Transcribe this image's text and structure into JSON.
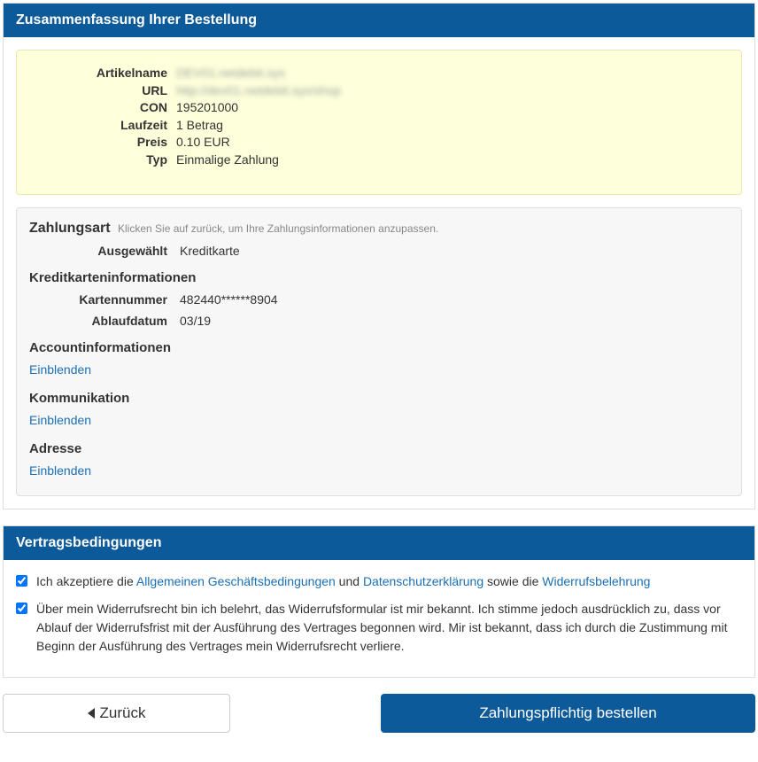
{
  "summary": {
    "header": "Zusammenfassung Ihrer Bestellung",
    "items": {
      "artikelname_label": "Artikelname",
      "artikelname_value": "DEV01.netdebit.sys",
      "url_label": "URL",
      "url_value": "http://dev01.netdebit.sys/shop",
      "con_label": "CON",
      "con_value": "195201000",
      "laufzeit_label": "Laufzeit",
      "laufzeit_value": "1 Betrag",
      "preis_label": "Preis",
      "preis_value": "0.10 EUR",
      "typ_label": "Typ",
      "typ_value": "Einmalige Zahlung"
    },
    "payment": {
      "title": "Zahlungsart",
      "hint": "Klicken Sie auf zurück, um Ihre Zahlungsinformationen anzupassen.",
      "selected_label": "Ausgewählt",
      "selected_value": "Kreditkarte"
    },
    "card": {
      "title": "Kreditkarteninformationen",
      "number_label": "Kartennummer",
      "number_value": "482440******8904",
      "expiry_label": "Ablaufdatum",
      "expiry_value": "03/19"
    },
    "account": {
      "title": "Accountinformationen",
      "toggle": "Einblenden"
    },
    "communication": {
      "title": "Kommunikation",
      "toggle": "Einblenden"
    },
    "address": {
      "title": "Adresse",
      "toggle": "Einblenden"
    }
  },
  "terms": {
    "header": "Vertragsbedingungen",
    "line1_prefix": "Ich akzeptiere die ",
    "line1_link1": "Allgemeinen Geschäftsbedingungen",
    "line1_mid1": " und ",
    "line1_link2": "Datenschutzerklärung",
    "line1_mid2": " sowie die ",
    "line1_link3": "Widerrufsbelehrung",
    "line2": "Über mein Widerrufsrecht bin ich belehrt, das Widerrufsformular ist mir bekannt. Ich stimme jedoch ausdrücklich zu, dass vor Ablauf der Widerrufsfrist mit der Ausführung des Vertrages begonnen wird. Mir ist bekannt, dass ich durch die Zustimmung mit Beginn der Ausführung des Vertrages mein Widerrufsrecht verliere."
  },
  "buttons": {
    "back": "Zurück",
    "order": "Zahlungspflichtig bestellen"
  }
}
